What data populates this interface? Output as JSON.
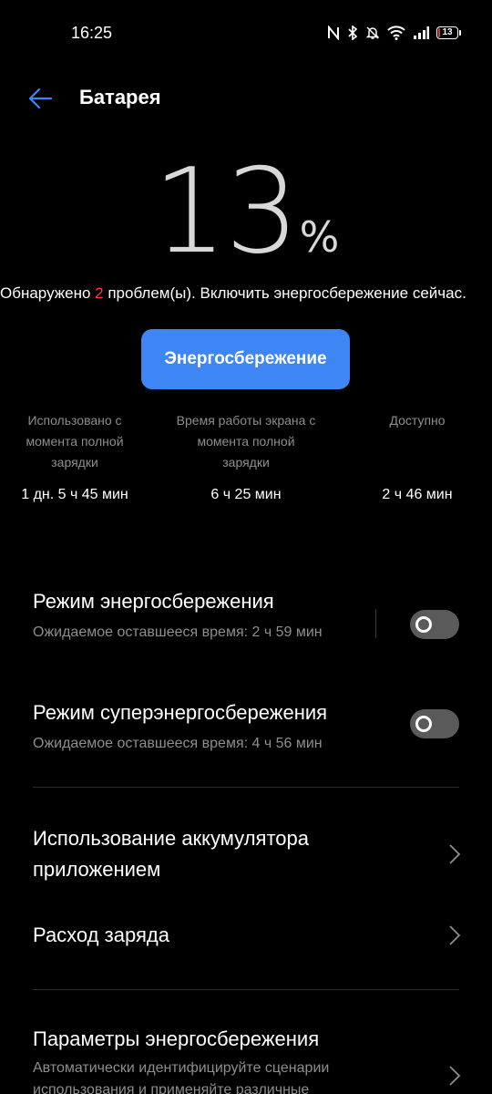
{
  "status_bar": {
    "time": "16:25",
    "battery_level": "13",
    "battery_color": "#e53935",
    "icons": [
      "nfc-icon",
      "bluetooth-icon",
      "mute-bell-icon",
      "wifi-icon",
      "signal-icon",
      "battery-icon"
    ]
  },
  "header": {
    "title": "Батарея",
    "back_icon": "arrow-left-icon"
  },
  "battery": {
    "percent": "13",
    "percent_sign": "%"
  },
  "problems": {
    "prefix": "Обнаружено ",
    "count": "2",
    "suffix": " проблем(ы). Включить энергосбережение сейчас."
  },
  "save_button": "Энергосбережение",
  "stats": [
    {
      "label": "Использовано с момента полной зарядки",
      "value": "1 дн. 5 ч 45 мин"
    },
    {
      "label": "Время работы экрана с момента полной зарядки",
      "value": "6 ч 25 мин"
    },
    {
      "label": "Доступно",
      "value": "2 ч 46 мин"
    }
  ],
  "power_saving": {
    "title": "Режим энергосбережения",
    "subtitle": "Ожидаемое оставшееся время:  2 ч 59 мин",
    "enabled": false
  },
  "super_power_saving": {
    "title": "Режим суперэнергосбережения",
    "subtitle": "Ожидаемое оставшееся время:  4 ч 56 мин",
    "enabled": false
  },
  "nav": {
    "app_usage": "Использование аккумулятора приложением",
    "consumption": "Расход заряда",
    "settings_title": "Параметры энергосбережения",
    "settings_sub": "Автоматически идентифицируйте сценарии использования и применяйте различные"
  },
  "colors": {
    "accent": "#3f86f5",
    "warning": "#ff3b30",
    "background": "#000000"
  }
}
